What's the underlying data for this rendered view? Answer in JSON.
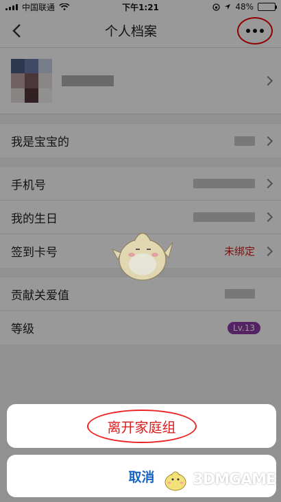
{
  "status_bar": {
    "carrier": "中国联通",
    "time": "下午1:21",
    "battery": "48%",
    "battery_level": 0.48
  },
  "header": {
    "title": "个人档案"
  },
  "rows_group1": [
    {
      "label": "我是宝宝的"
    }
  ],
  "rows_group2": [
    {
      "label": "手机号"
    },
    {
      "label": "我的生日"
    },
    {
      "label": "签到卡号",
      "value": "未绑定"
    }
  ],
  "rows_group3": [
    {
      "label": "贡献关爱值"
    },
    {
      "label": "等级",
      "badge": "Lv.13"
    }
  ],
  "action_sheet": {
    "leave_label": "离开家庭组",
    "cancel_label": "取消"
  },
  "watermark": {
    "text": "3DMGAME"
  },
  "colors": {
    "accent_red": "#d91f1f",
    "link_blue": "#1565c0",
    "level_badge": "#8e3aa7"
  }
}
